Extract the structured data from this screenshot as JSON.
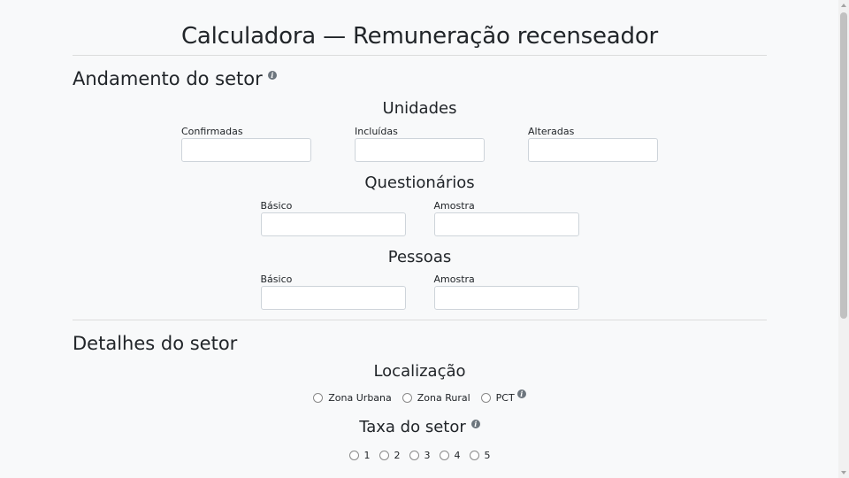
{
  "page": {
    "title": "Calculadora — Remuneração recenseador"
  },
  "andamento": {
    "title": "Andamento do setor",
    "info_glyph": "i",
    "unidades": {
      "title": "Unidades",
      "fields": [
        {
          "label": "Confirmadas",
          "value": ""
        },
        {
          "label": "Incluídas",
          "value": ""
        },
        {
          "label": "Alteradas",
          "value": ""
        }
      ]
    },
    "questionarios": {
      "title": "Questionários",
      "fields": [
        {
          "label": "Básico",
          "value": ""
        },
        {
          "label": "Amostra",
          "value": ""
        }
      ]
    },
    "pessoas": {
      "title": "Pessoas",
      "fields": [
        {
          "label": "Básico",
          "value": ""
        },
        {
          "label": "Amostra",
          "value": ""
        }
      ]
    }
  },
  "detalhes": {
    "title": "Detalhes do setor",
    "localizacao": {
      "title": "Localização",
      "options": [
        "Zona Urbana",
        "Zona Rural",
        "PCT"
      ],
      "info_glyph": "i"
    },
    "taxa": {
      "title": "Taxa do setor",
      "info_glyph": "i",
      "options": [
        "1",
        "2",
        "3",
        "4",
        "5"
      ]
    }
  },
  "colors": {
    "background": "#f8f9fa",
    "text": "#212529",
    "border": "#ced4da",
    "info": "#6c757d"
  }
}
